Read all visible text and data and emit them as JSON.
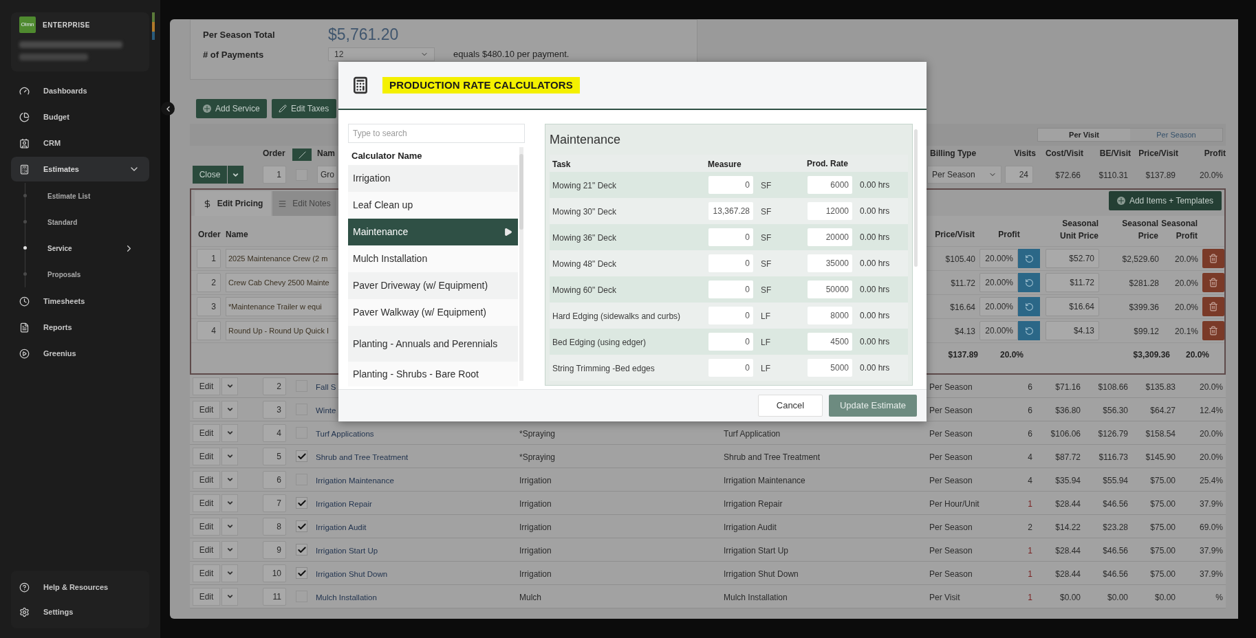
{
  "sidebar": {
    "logo": "Olmn",
    "brand": "ENTERPRISE",
    "items": [
      {
        "label": "Dashboards",
        "selected": false
      },
      {
        "label": "Budget",
        "selected": false
      },
      {
        "label": "CRM",
        "selected": false
      },
      {
        "label": "Estimates",
        "selected": true,
        "expanded": true,
        "children": [
          {
            "label": "Estimate List",
            "selected": false
          },
          {
            "label": "Standard",
            "selected": false
          },
          {
            "label": "Service",
            "selected": true,
            "expanded": false
          },
          {
            "label": "Proposals",
            "selected": false
          }
        ]
      },
      {
        "label": "Timesheets",
        "selected": false
      },
      {
        "label": "Reports",
        "selected": false
      },
      {
        "label": "Greenius",
        "selected": false
      }
    ],
    "footer_items": [
      {
        "label": "Help & Resources"
      },
      {
        "label": "Settings"
      }
    ]
  },
  "summary": {
    "total_label": "Per Season Total",
    "total": "$5,761.20",
    "payments_label": "# of Payments",
    "payments": "12",
    "payments_note": "equals $480.10 per payment."
  },
  "toolbar": [
    "Add Service",
    "Edit Taxes"
  ],
  "view_toggle": [
    {
      "label": "Per Visit",
      "selected": true
    },
    {
      "label": "Per Season",
      "selected": false
    }
  ],
  "columns": {
    "order": "Order",
    "name": "Nam",
    "billing_type": "Billing Type",
    "visits": "Visits",
    "cost": "Cost/Visit",
    "be": "BE/Visit",
    "price": "Price/Visit",
    "profit": "Profit"
  },
  "open_row": {
    "action": "Close",
    "order": "1",
    "checked": false,
    "name": "Gro",
    "billing_type": "Per Season",
    "visits": "24",
    "cost": "$72.66",
    "be": "$110.31",
    "price": "$137.89",
    "profit": "20.0%",
    "tabs": [
      {
        "label": "Edit Pricing",
        "selected": true
      },
      {
        "label": "Edit Notes",
        "selected": false
      }
    ],
    "add_button": "Add Items + Templates",
    "item_columns": {
      "order": "Order",
      "name": "Name",
      "price": "Price/Visit",
      "profit": "Profit",
      "unit_price": "Seasonal Unit Price",
      "seasonal_price": "Seasonal Price",
      "seasonal_profit": "Seasonal Profit"
    },
    "items": [
      {
        "order": "1",
        "name": "2025 Maintenance Crew (2 m",
        "price": "$105.40",
        "profit": "20.00%",
        "unit_price": "$52.70",
        "seasonal_price": "$2,529.60",
        "seasonal_profit": "20.0%"
      },
      {
        "order": "2",
        "name": "Crew Cab Chevy 2500 Mainte",
        "price": "$11.72",
        "profit": "20.00%",
        "unit_price": "$11.72",
        "seasonal_price": "$281.28",
        "seasonal_profit": "20.0%"
      },
      {
        "order": "3",
        "name": "*Maintenance Trailer w equi",
        "price": "$16.64",
        "profit": "20.00%",
        "unit_price": "$16.64",
        "seasonal_price": "$399.36",
        "seasonal_profit": "20.0%"
      },
      {
        "order": "4",
        "name": "Round Up - Round Up Quick I",
        "price": "$4.13",
        "profit": "20.00%",
        "unit_price": "$4.13",
        "seasonal_price": "$99.12",
        "seasonal_profit": "20.1%"
      }
    ],
    "totals": {
      "price": "$137.89",
      "profit": "20.0%",
      "seasonal_price": "$3,309.36",
      "seasonal_profit": "20.0%"
    }
  },
  "rows": [
    {
      "action": "Edit",
      "order": "2",
      "checked": false,
      "name": "Fall S",
      "billing_type": "Per Season",
      "visits": "6",
      "warning": false,
      "cost": "$71.16",
      "be": "$108.66",
      "price": "$135.83",
      "profit": "20.0%"
    },
    {
      "action": "Edit",
      "order": "3",
      "checked": false,
      "name": "Winte",
      "billing_type": "Per Season",
      "visits": "6",
      "warning": false,
      "cost": "$36.80",
      "be": "$56.30",
      "price": "$64.27",
      "profit": "12.4%"
    },
    {
      "action": "Edit",
      "order": "4",
      "checked": false,
      "name": "Turf Applications",
      "category": "*Spraying",
      "service": "Turf Application",
      "billing_type": "Per Season",
      "visits": "6",
      "warning": false,
      "cost": "$106.06",
      "be": "$126.79",
      "price": "$158.54",
      "profit": "20.0%"
    },
    {
      "action": "Edit",
      "order": "5",
      "checked": true,
      "name": "Shrub and Tree Treatment",
      "category": "*Spraying",
      "service": "Shrub and Tree Treatment",
      "billing_type": "Per Season",
      "visits": "4",
      "warning": false,
      "cost": "$87.72",
      "be": "$116.73",
      "price": "$145.90",
      "profit": "20.0%"
    },
    {
      "action": "Edit",
      "order": "6",
      "checked": false,
      "name": "Irrigation Maintenance",
      "category": "Irrigation",
      "service": "Irrigation Maintenance",
      "billing_type": "Per Season",
      "visits": "4",
      "warning": false,
      "cost": "$35.94",
      "be": "$55.94",
      "price": "$75.00",
      "profit": "25.4%"
    },
    {
      "action": "Edit",
      "order": "7",
      "checked": true,
      "name": "Irrigation Repair",
      "category": "Irrigation",
      "service": "Irrigation Repair",
      "billing_type": "Per Hour/Unit",
      "visits": "1",
      "warning": true,
      "cost": "$28.44",
      "be": "$46.56",
      "price": "$75.00",
      "profit": "37.9%"
    },
    {
      "action": "Edit",
      "order": "8",
      "checked": true,
      "name": "Irrigation Audit",
      "category": "Irrigation",
      "service": "Irrigation Audit",
      "billing_type": "Per Season",
      "visits": "2",
      "warning": false,
      "cost": "$14.22",
      "be": "$23.28",
      "price": "$75.00",
      "profit": "69.0%"
    },
    {
      "action": "Edit",
      "order": "9",
      "checked": true,
      "name": "Irrigation Start Up",
      "category": "Irrigation",
      "service": "Irrigation Start Up",
      "billing_type": "Per Season",
      "visits": "1",
      "warning": true,
      "cost": "$28.44",
      "be": "$46.56",
      "price": "$75.00",
      "profit": "37.9%"
    },
    {
      "action": "Edit",
      "order": "10",
      "checked": true,
      "name": "Irrigation Shut Down",
      "category": "Irrigation",
      "service": "Irrigation Shut Down",
      "billing_type": "Per Season",
      "visits": "1",
      "warning": true,
      "cost": "$28.44",
      "be": "$46.56",
      "price": "$75.00",
      "profit": "37.9%"
    },
    {
      "action": "Edit",
      "order": "11",
      "checked": false,
      "name": "Mulch Installation",
      "category": "Mulch",
      "service": "Mulch Installation",
      "billing_type": "Per Visit",
      "visits": "1",
      "warning": true,
      "cost": "$0.00",
      "be": "$0.00",
      "price": "$0.00",
      "profit": "%"
    }
  ],
  "modal": {
    "title": "PRODUCTION RATE CALCULATORS",
    "search_placeholder": "Type to search",
    "list_header": "Calculator Name",
    "calculators": [
      {
        "label": "Irrigation",
        "selected": false
      },
      {
        "label": "Leaf Clean up",
        "selected": false
      },
      {
        "label": "Maintenance",
        "selected": true
      },
      {
        "label": "Mulch Installation",
        "selected": false
      },
      {
        "label": "Paver Driveway (w/ Equipment)",
        "selected": false
      },
      {
        "label": "Paver Walkway (w/ Equipment)",
        "selected": false
      },
      {
        "label": "Planting - Annuals and Perennials",
        "selected": false
      },
      {
        "label": "Planting - Shrubs - Bare Root",
        "selected": false
      }
    ],
    "panel": {
      "title": "Maintenance",
      "columns": {
        "task": "Task",
        "measure": "Measure",
        "rate": "Prod. Rate"
      },
      "tasks": [
        {
          "task": "Mowing 21\" Deck",
          "measure": "0",
          "unit": "SF",
          "rate": "6000",
          "hours": "0.00 hrs"
        },
        {
          "task": "Mowing 30\" Deck",
          "measure": "13,367.28",
          "unit": "SF",
          "rate": "12000",
          "hours": "0.00 hrs"
        },
        {
          "task": "Mowing 36\" Deck",
          "measure": "0",
          "unit": "SF",
          "rate": "20000",
          "hours": "0.00 hrs"
        },
        {
          "task": "Mowing 48\" Deck",
          "measure": "0",
          "unit": "SF",
          "rate": "35000",
          "hours": "0.00 hrs"
        },
        {
          "task": "Mowing 60\" Deck",
          "measure": "0",
          "unit": "SF",
          "rate": "50000",
          "hours": "0.00 hrs"
        },
        {
          "task": "Hard Edging (sidewalks and curbs)",
          "measure": "0",
          "unit": "LF",
          "rate": "8000",
          "hours": "0.00 hrs"
        },
        {
          "task": "Bed Edging (using edger)",
          "measure": "0",
          "unit": "LF",
          "rate": "4500",
          "hours": "0.00 hrs"
        },
        {
          "task": "String Trimming -Bed edges",
          "measure": "0",
          "unit": "LF",
          "rate": "5000",
          "hours": "0.00 hrs"
        }
      ]
    },
    "buttons": [
      {
        "label": "Cancel",
        "kind": "secondary",
        "disabled": false
      },
      {
        "label": "Update Estimate",
        "kind": "primary",
        "disabled": true
      }
    ]
  }
}
